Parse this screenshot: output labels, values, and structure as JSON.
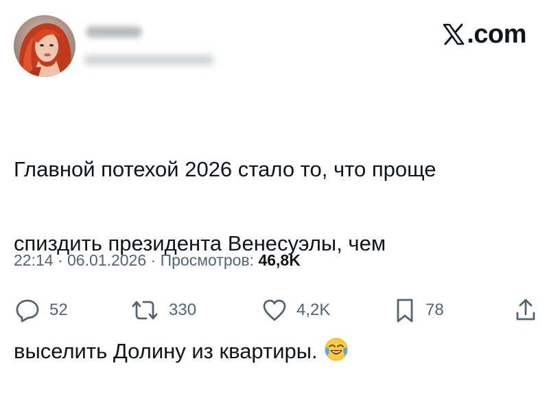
{
  "header": {
    "avatar_icon": "user-avatar-photo",
    "display_name": "",
    "handle": "",
    "brand_logo_icon": "x-logo-icon",
    "brand_text": ".com"
  },
  "tweet": {
    "lines": [
      "Главной потехой 2026 стало то, что проще",
      "спиздить президента Венесуэлы, чем",
      "выселить Долину из квартиры."
    ],
    "emoji": "face-with-tears-of-joy-emoji"
  },
  "meta": {
    "time": "22:14",
    "separator": "·",
    "date": "06.01.2026",
    "views_label": "Просмотров:",
    "views_count": "46,8K"
  },
  "actions": {
    "reply": {
      "icon": "reply-icon",
      "count": "52"
    },
    "repost": {
      "icon": "repost-icon",
      "count": "330"
    },
    "like": {
      "icon": "heart-icon",
      "count": "4,2K"
    },
    "bookmark": {
      "icon": "bookmark-icon",
      "count": "78"
    },
    "share": {
      "icon": "share-icon"
    }
  },
  "colors": {
    "text": "#0f1419",
    "secondary": "#536471",
    "background": "#ffffff"
  }
}
